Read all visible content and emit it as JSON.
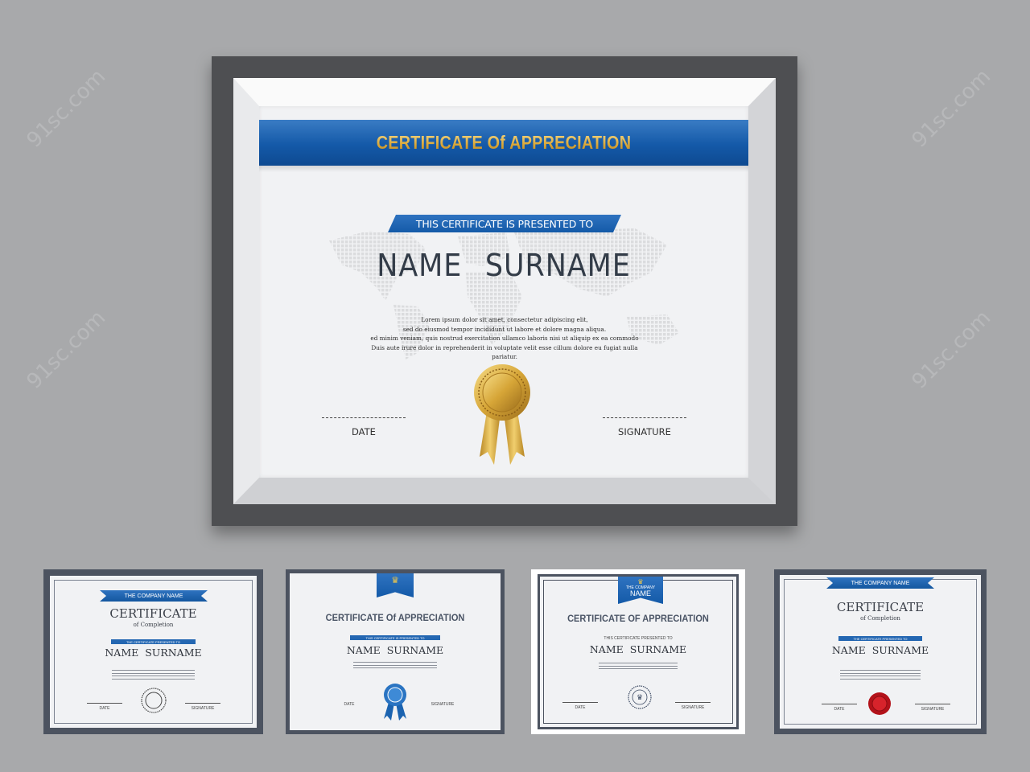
{
  "main_certificate": {
    "title": "CERTIFICATE Of APPRECIATION",
    "presented_to": "THIS CERTIFICATE IS PRESENTED TO",
    "recipient": "NAME   SURNAME",
    "body_lines": [
      "Lorem ipsum dolor sit amet, consectetur adipiscing elit,",
      "sed do eiusmod tempor incididunt ut labore et dolore magna aliqua.",
      "ed minim veniam, quis nostrud exercitation ullamco laboris nisi ut aliquip ex ea commodo",
      "Duis aute irure dolor in reprehenderit in voluptate velit esse cillum dolore eu fugiat nulla pariatur."
    ],
    "date_label": "DATE",
    "signature_label": "SIGNATURE",
    "seal_color": "#d8a93a",
    "accent_color": "#1459a8"
  },
  "thumbnails": [
    {
      "banner": "THE COMPANY NAME",
      "heading": "CERTIFICATE",
      "subheading": "of Completion",
      "presented_to": "THE CERTIFICATE PRESENTED TO",
      "recipient": "NAME SURNAME",
      "date_label": "DATE",
      "signature_label": "SIGNATURE",
      "seal": "outline-seal"
    },
    {
      "heading": "CERTIFICATE Of APPRECIATION",
      "presented_to": "THIS CERTIFICATE IS PRESENTED TO",
      "recipient": "NAME SURNAME",
      "date_label": "DATE",
      "signature_label": "SIGNATURE",
      "seal": "blue-rosette"
    },
    {
      "pennant_top": "THE COMPANY",
      "pennant_bottom": "NAME",
      "heading": "CERTIFICATE OF APPRECIATION",
      "presented_to": "THIS CERTIFICATE PRESENTED TO",
      "recipient": "NAME SURNAME",
      "date_label": "DATE",
      "signature_label": "SIGNATURE",
      "seal": "crown-stamp"
    },
    {
      "banner": "THE COMPANY NAME",
      "heading": "CERTIFICATE",
      "subheading": "of Completion",
      "presented_to": "THE CERTIFICATE PRESENTED TO",
      "recipient": "NAME SURNAME",
      "date_label": "DATE",
      "signature_label": "SIGNATURE",
      "seal": "red-wax-seal"
    }
  ],
  "watermark": "91sc.com"
}
